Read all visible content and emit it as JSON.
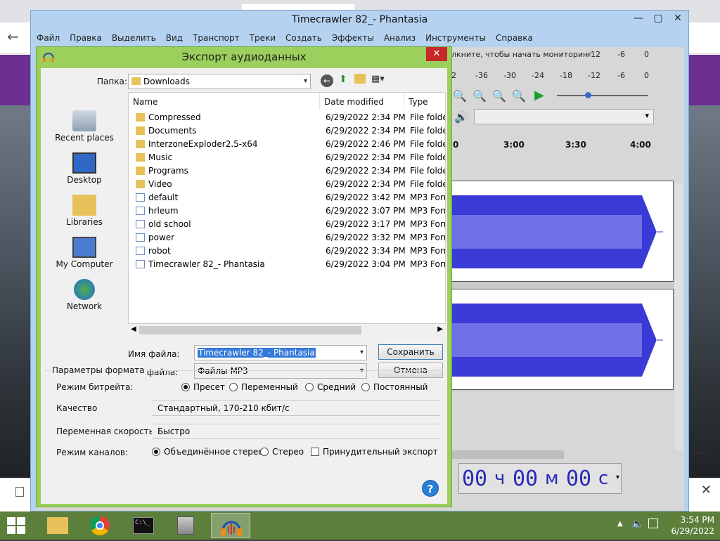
{
  "audacity": {
    "title": "Timecrawler 82_- Phantasia",
    "menu": [
      "Файл",
      "Правка",
      "Выделить",
      "Вид",
      "Транспорт",
      "Треки",
      "Создать",
      "Эффекты",
      "Анализ",
      "Инструменты",
      "Справка"
    ],
    "monitor_hint": "лкните, чтобы начать мониторинг",
    "meter_top": [
      "-12",
      "-6",
      "0"
    ],
    "meter_bottom": [
      "2",
      "-36",
      "-30",
      "-24",
      "-18",
      "-12",
      "-6",
      "0"
    ],
    "ruler": [
      "0",
      "3:00",
      "3:30",
      "4:00"
    ],
    "time_display": {
      "hours": "00",
      "h_unit": "ч",
      "minutes": "00",
      "m_unit": "м",
      "seconds": "00",
      "s_unit": "с"
    }
  },
  "dialog": {
    "title": "Экспорт аудиоданных",
    "folder_label": "Папка:",
    "folder_value": "Downloads",
    "places": [
      "Recent places",
      "Desktop",
      "Libraries",
      "My Computer",
      "Network"
    ],
    "columns": [
      "Name",
      "Date modified",
      "Type"
    ],
    "files": [
      {
        "name": "Compressed",
        "date": "6/29/2022 2:34 PM",
        "type": "File folder",
        "kind": "folder"
      },
      {
        "name": "Documents",
        "date": "6/29/2022 2:34 PM",
        "type": "File folder",
        "kind": "folder"
      },
      {
        "name": "InterzoneExploder2.5-x64",
        "date": "6/29/2022 2:46 PM",
        "type": "File folder",
        "kind": "folder"
      },
      {
        "name": "Music",
        "date": "6/29/2022 2:34 PM",
        "type": "File folder",
        "kind": "folder"
      },
      {
        "name": "Programs",
        "date": "6/29/2022 2:34 PM",
        "type": "File folder",
        "kind": "folder"
      },
      {
        "name": "Video",
        "date": "6/29/2022 2:34 PM",
        "type": "File folder",
        "kind": "folder"
      },
      {
        "name": "default",
        "date": "6/29/2022 3:42 PM",
        "type": "MP3 Form",
        "kind": "file"
      },
      {
        "name": "hrleum",
        "date": "6/29/2022 3:07 PM",
        "type": "MP3 Form",
        "kind": "file"
      },
      {
        "name": "old school",
        "date": "6/29/2022 3:17 PM",
        "type": "MP3 Form",
        "kind": "file"
      },
      {
        "name": "power",
        "date": "6/29/2022 3:32 PM",
        "type": "MP3 Form",
        "kind": "file"
      },
      {
        "name": "robot",
        "date": "6/29/2022 3:34 PM",
        "type": "MP3 Form",
        "kind": "file"
      },
      {
        "name": "Timecrawler 82_- Phantasia",
        "date": "6/29/2022 3:04 PM",
        "type": "MP3 Form",
        "kind": "file"
      }
    ],
    "filename_label": "Имя файла:",
    "filename_value": "Timecrawler 82_- Phantasia",
    "filetype_label": "Тип файла:",
    "filetype_value": "Файлы MP3",
    "save_label": "Сохранить",
    "cancel_label": "Отмена",
    "format_group_title": "Параметры формата",
    "bitrate_label": "Режим битрейта:",
    "bitrate_options": [
      "Пресет",
      "Переменный",
      "Средний",
      "Постоянный"
    ],
    "bitrate_selected": 0,
    "quality_label": "Качество",
    "quality_value": "Стандартный, 170-210 кбит/с",
    "varspeed_label": "Переменная скорость:",
    "varspeed_value": "Быстро",
    "channel_label": "Режим каналов:",
    "channel_options": [
      "Объединённое стерео",
      "Стерео"
    ],
    "channel_selected": 0,
    "force_mono_label": "Принудительный экспорт в мо",
    "help_label": "?"
  },
  "taskbar": {
    "time": "3:54 PM",
    "date": "6/29/2022"
  },
  "browser": {
    "right_fragment": "erms"
  },
  "colors": {
    "dialog_frame": "#9bd05c",
    "taskbar": "#5d7f3c",
    "waveform": "#3a3ad6",
    "close_red": "#c7282a"
  }
}
